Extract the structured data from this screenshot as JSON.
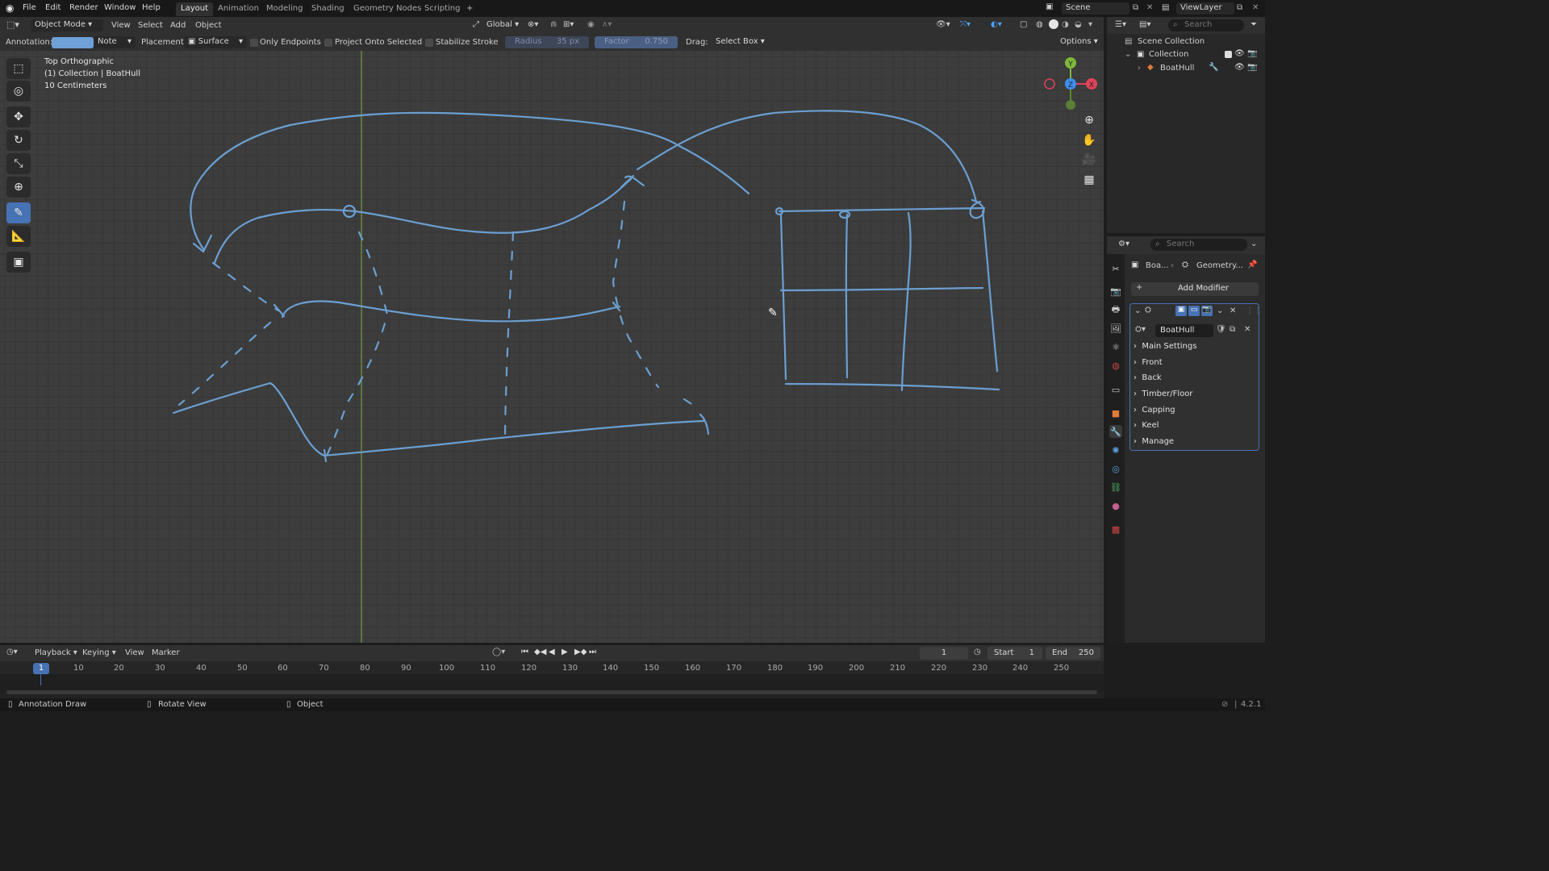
{
  "topbar": {
    "menus": [
      "File",
      "Edit",
      "Render",
      "Window",
      "Help"
    ],
    "workspaces": [
      "Layout",
      "Animation",
      "Modeling",
      "Shading",
      "Geometry Nodes",
      "Scripting"
    ],
    "add_tab": "+",
    "scene": "Scene",
    "view_layer": "ViewLayer"
  },
  "header": {
    "mode": "Object Mode",
    "menus": [
      "View",
      "Select",
      "Add",
      "Object"
    ],
    "orientation": "Global",
    "tool_settings": {
      "annotation_label": "Annotation:",
      "annotation_color": "#6fa0d8",
      "note_layer": "Note",
      "placement_label": "Placement:",
      "placement": "Surface",
      "only_endpoints": "Only Endpoints",
      "project_onto_selected": "Project Onto Selected",
      "stabilize_stroke": "Stabilize Stroke",
      "radius_label": "Radius",
      "radius_value": "35 px",
      "factor_label": "Factor",
      "factor_value": "0.750",
      "drag_label": "Drag:",
      "drag_value": "Select Box",
      "options": "Options"
    }
  },
  "viewport": {
    "view_name": "Top Orthographic",
    "collection_info": "(1) Collection | BoatHull",
    "scale": "10 Centimeters",
    "stroke_color": "#6b9fd1",
    "grid_line_color": "#3a3a3a"
  },
  "gizmo": {
    "y": "Y",
    "x": "X",
    "z": "Z"
  },
  "outliner": {
    "search_placeholder": "Search",
    "items": [
      {
        "label": "Scene Collection"
      },
      {
        "label": "Collection"
      },
      {
        "label": "BoatHull"
      }
    ]
  },
  "properties": {
    "search_placeholder": "Search",
    "breadcrumb_object": "Boa...",
    "breadcrumb_modifier": "Geometry...",
    "add_modifier": "Add Modifier",
    "modifier_name": "BoatHull",
    "sections": [
      "Main Settings",
      "Front",
      "Back",
      "Timber/Floor",
      "Capping",
      "Keel",
      "Manage"
    ]
  },
  "timeline": {
    "menus": [
      "Playback",
      "Keying",
      "View",
      "Marker"
    ],
    "current_frame": "1",
    "start_label": "Start",
    "start": "1",
    "end_label": "End",
    "end": "250",
    "ticks": [
      "1",
      "10",
      "20",
      "30",
      "40",
      "50",
      "60",
      "70",
      "80",
      "90",
      "100",
      "110",
      "120",
      "130",
      "140",
      "150",
      "160",
      "170",
      "180",
      "190",
      "200",
      "210",
      "220",
      "230",
      "240",
      "250"
    ]
  },
  "statusbar": {
    "left": "Annotation Draw",
    "middle": "Rotate View",
    "right": "Object",
    "version": "4.2.1"
  }
}
